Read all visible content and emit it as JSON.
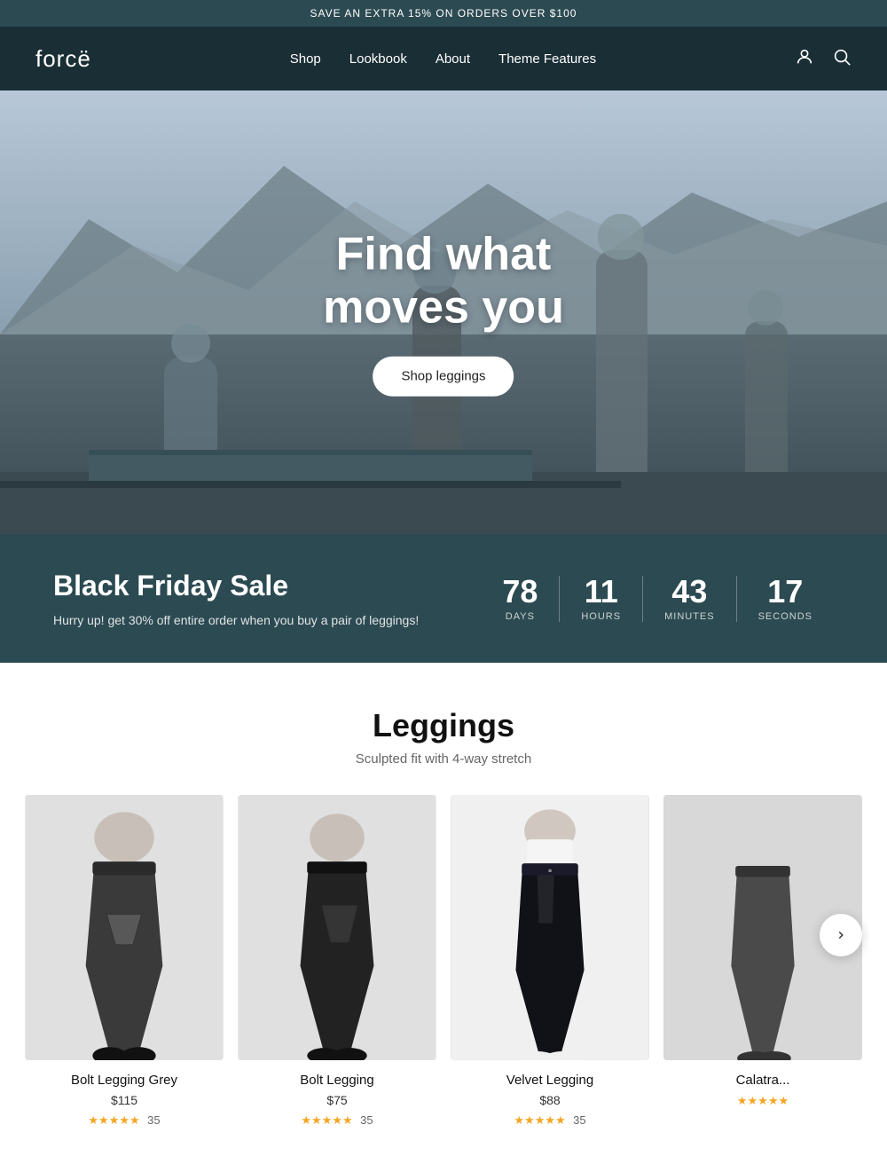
{
  "announcement": {
    "text": "SAVE AN EXTRA 15% ON ORDERS OVER $100"
  },
  "header": {
    "logo": "forcë",
    "nav": [
      {
        "label": "Shop",
        "href": "#"
      },
      {
        "label": "Lookbook",
        "href": "#"
      },
      {
        "label": "About",
        "href": "#"
      },
      {
        "label": "Theme Features",
        "href": "#"
      }
    ],
    "account_icon": "👤",
    "search_icon": "🔍"
  },
  "hero": {
    "title_line1": "Find what",
    "title_line2": "moves you",
    "cta_label": "Shop leggings"
  },
  "countdown": {
    "title": "Black Friday Sale",
    "subtitle": "Hurry up! get 30% off entire order when you buy a pair of leggings!",
    "days_val": "78",
    "days_label": "DAYS",
    "hours_val": "11",
    "hours_label": "HOURS",
    "minutes_val": "43",
    "minutes_label": "MINUTES",
    "seconds_val": "17",
    "seconds_label": "SECONDS"
  },
  "products": {
    "title": "Leggings",
    "subtitle": "Sculpted fit with 4-way stretch",
    "items": [
      {
        "name": "Bolt Legging Grey",
        "price": "$115",
        "stars": "★★★★★",
        "reviews": "35"
      },
      {
        "name": "Bolt Legging",
        "price": "$75",
        "stars": "★★★★★",
        "reviews": "35"
      },
      {
        "name": "Velvet Legging",
        "price": "$88",
        "stars": "★★★★★",
        "reviews": "35"
      },
      {
        "name": "Calatra...",
        "price": "",
        "stars": "★★★★★",
        "reviews": ""
      }
    ]
  }
}
